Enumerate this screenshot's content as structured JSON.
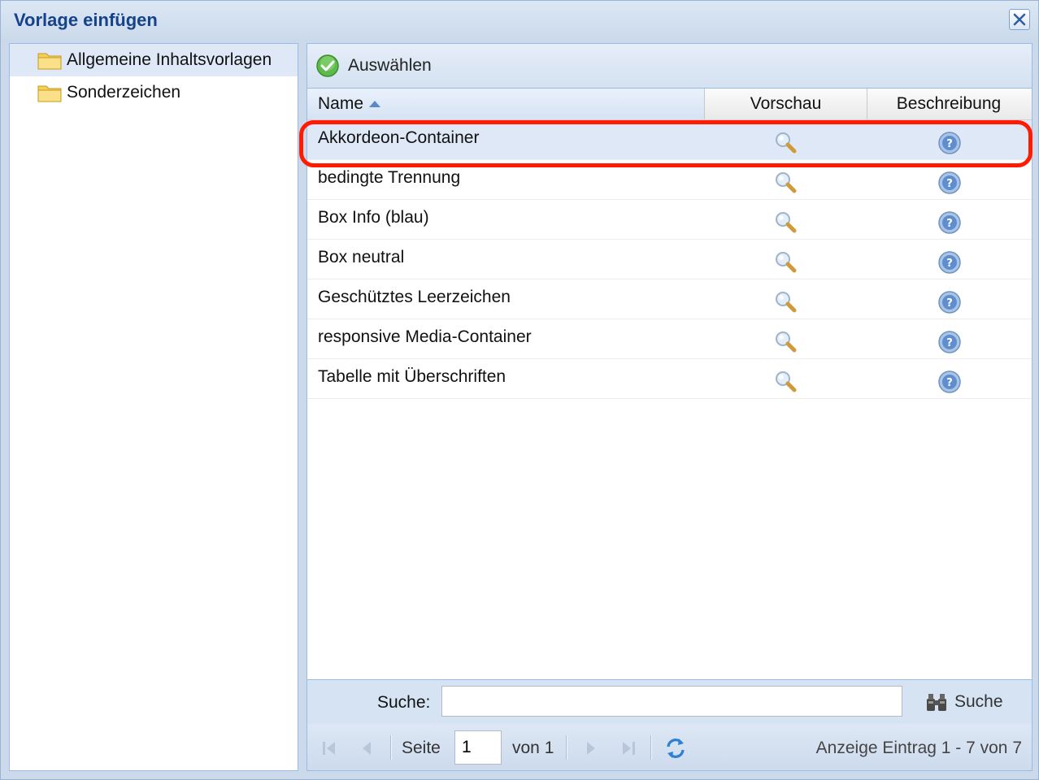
{
  "dialog": {
    "title": "Vorlage einfügen",
    "close_icon": "close-icon"
  },
  "tree": {
    "items": [
      {
        "label": "Allgemeine Inhaltsvorlagen",
        "icon": "folder-icon",
        "selected": true
      },
      {
        "label": "Sonderzeichen",
        "icon": "folder-icon",
        "selected": false
      }
    ]
  },
  "toolbar": {
    "select_label": "Auswählen",
    "select_icon": "check-circle-icon"
  },
  "grid": {
    "columns": {
      "name": "Name",
      "preview": "Vorschau",
      "description": "Beschreibung"
    },
    "sort": {
      "column": "name",
      "direction": "ascending"
    },
    "rows": [
      {
        "name": "Akkordeon-Container",
        "selected": true
      },
      {
        "name": "bedingte Trennung",
        "selected": false
      },
      {
        "name": "Box Info (blau)",
        "selected": false
      },
      {
        "name": "Box neutral",
        "selected": false
      },
      {
        "name": "Geschütztes Leerzeichen",
        "selected": false
      },
      {
        "name": "responsive Media-Container",
        "selected": false
      },
      {
        "name": "Tabelle mit Überschriften",
        "selected": false
      }
    ],
    "row_icons": {
      "preview": "magnifier-icon",
      "description": "help-icon"
    }
  },
  "search": {
    "label": "Suche:",
    "value": "",
    "button_label": "Suche",
    "button_icon": "binoculars-icon"
  },
  "pager": {
    "page_label": "Seite",
    "page_value": "1",
    "of_label": "von 1",
    "info": "Anzeige Eintrag 1 - 7 von 7"
  },
  "colors": {
    "title": "#15428b",
    "selection": "#dfe8f6",
    "highlight": "#ff1a00"
  }
}
